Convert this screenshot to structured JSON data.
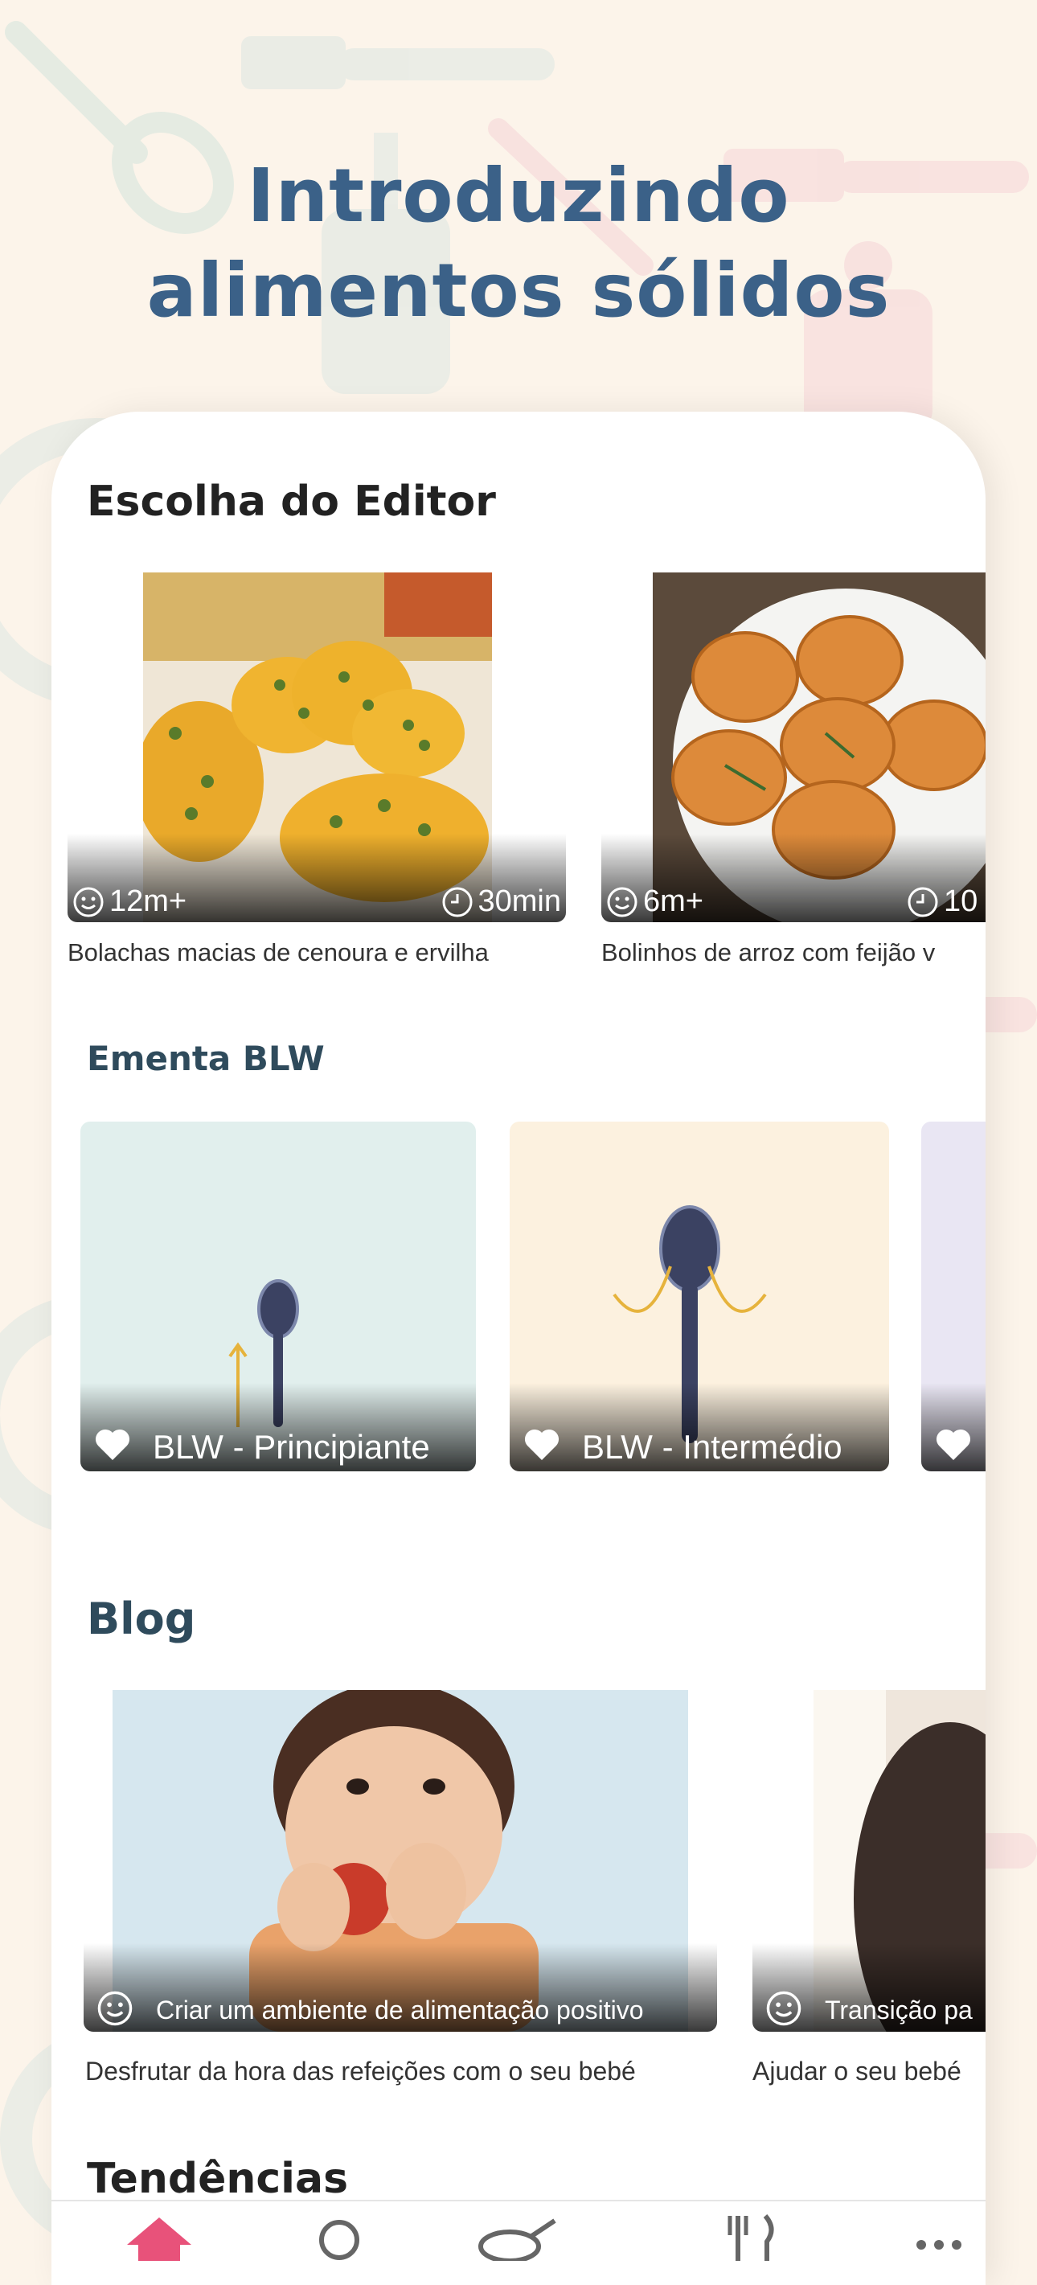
{
  "headline": {
    "line1": "Introduzindo",
    "line2": "alimentos sólidos"
  },
  "editors_choice": {
    "title": "Escolha do Editor",
    "cards": [
      {
        "age": "12m+",
        "time": "30min",
        "caption": "Bolachas macias de cenoura e ervilha"
      },
      {
        "age": "6m+",
        "time": "10",
        "caption": "Bolinhos de arroz com feijão v"
      }
    ]
  },
  "blw_menu": {
    "title": "Ementa BLW",
    "cards": [
      {
        "label": "BLW - Principiante"
      },
      {
        "label": "BLW - Intermédio"
      }
    ]
  },
  "blog": {
    "title": "Blog",
    "cards": [
      {
        "tag": "Criar um ambiente de alimentação positivo",
        "caption": "Desfrutar da hora das refeições com o seu bebé"
      },
      {
        "tag": "Transição pa",
        "caption": "Ajudar o seu bebé"
      }
    ]
  },
  "trending": {
    "title": "Tendências"
  },
  "tabbar": {
    "active_color": "#e8527a",
    "icons": [
      "home-icon",
      "search-icon",
      "pan-icon",
      "utensils-icon",
      "more-icon"
    ]
  },
  "colors": {
    "headline": "#3b6188",
    "background": "#fcf4ea",
    "blw_beginner_bg": "#e1efed",
    "blw_intermediate_bg": "#fcf1df"
  }
}
